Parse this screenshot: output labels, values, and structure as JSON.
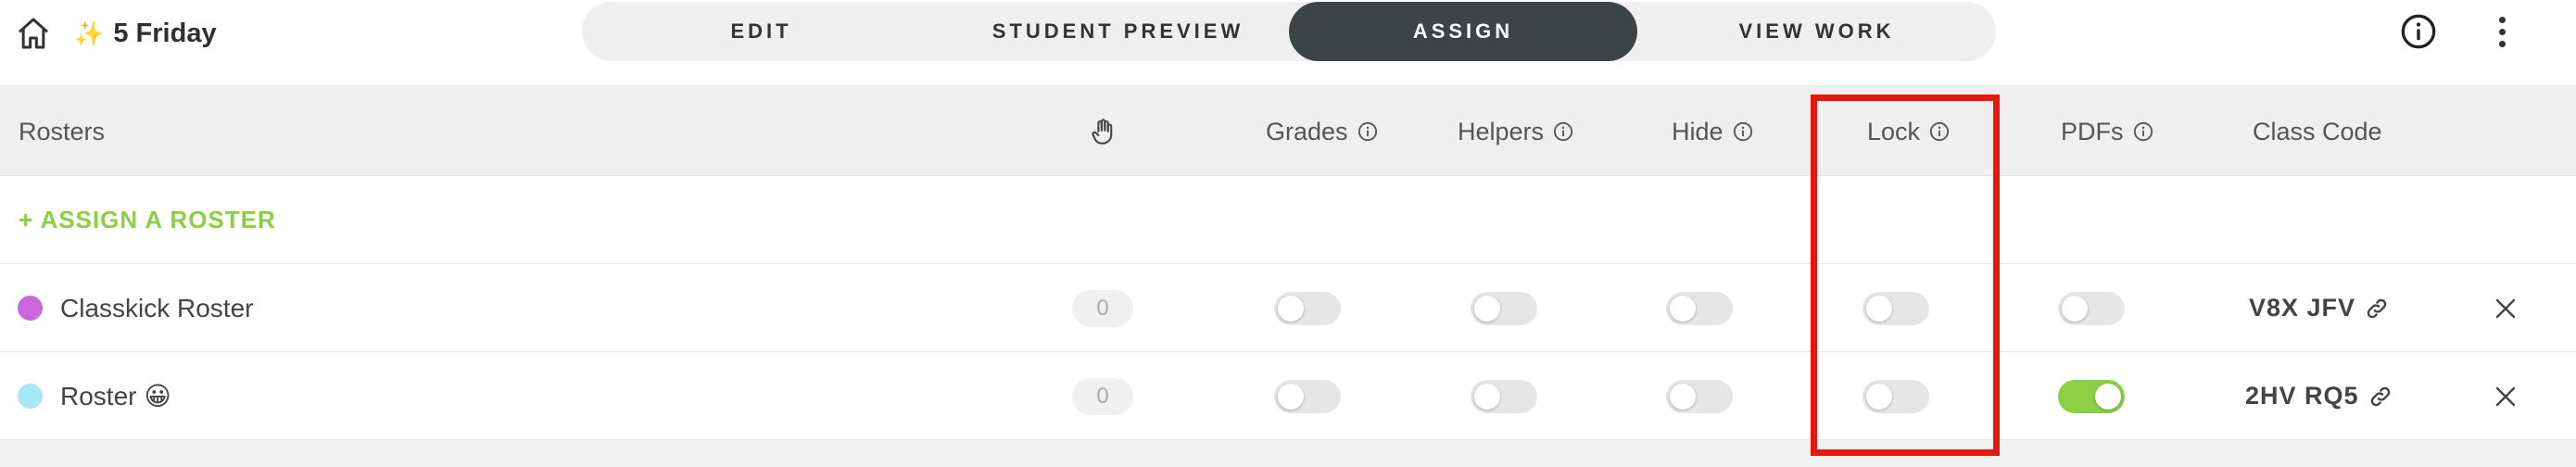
{
  "header": {
    "title": "5 Friday",
    "sparkle": "✨"
  },
  "tabs": [
    {
      "label": "EDIT",
      "active": false
    },
    {
      "label": "STUDENT PREVIEW",
      "active": false
    },
    {
      "label": "ASSIGN",
      "active": true
    },
    {
      "label": "VIEW WORK",
      "active": false
    }
  ],
  "table": {
    "columns": {
      "rosters": "Rosters",
      "grades": "Grades",
      "helpers": "Helpers",
      "hide": "Hide",
      "lock": "Lock",
      "pdfs": "PDFs",
      "class_code": "Class Code"
    },
    "assign_label": "+ ASSIGN A ROSTER",
    "rows": [
      {
        "name": "Classkick Roster",
        "emoji": "",
        "dot_color": "#cc66dd",
        "hand_count": "0",
        "grades": false,
        "helpers": false,
        "hide": false,
        "lock": false,
        "pdfs": false,
        "class_code": "V8X JFV"
      },
      {
        "name": "Roster",
        "emoji": "😀",
        "dot_color": "#a6e8f4",
        "hand_count": "0",
        "grades": false,
        "helpers": false,
        "hide": false,
        "lock": false,
        "pdfs": true,
        "class_code": "2HV RQ5"
      }
    ]
  },
  "colors": {
    "accent_green": "#8ccf45",
    "active_tab": "#3e4345",
    "highlight_red": "#e3190f"
  }
}
